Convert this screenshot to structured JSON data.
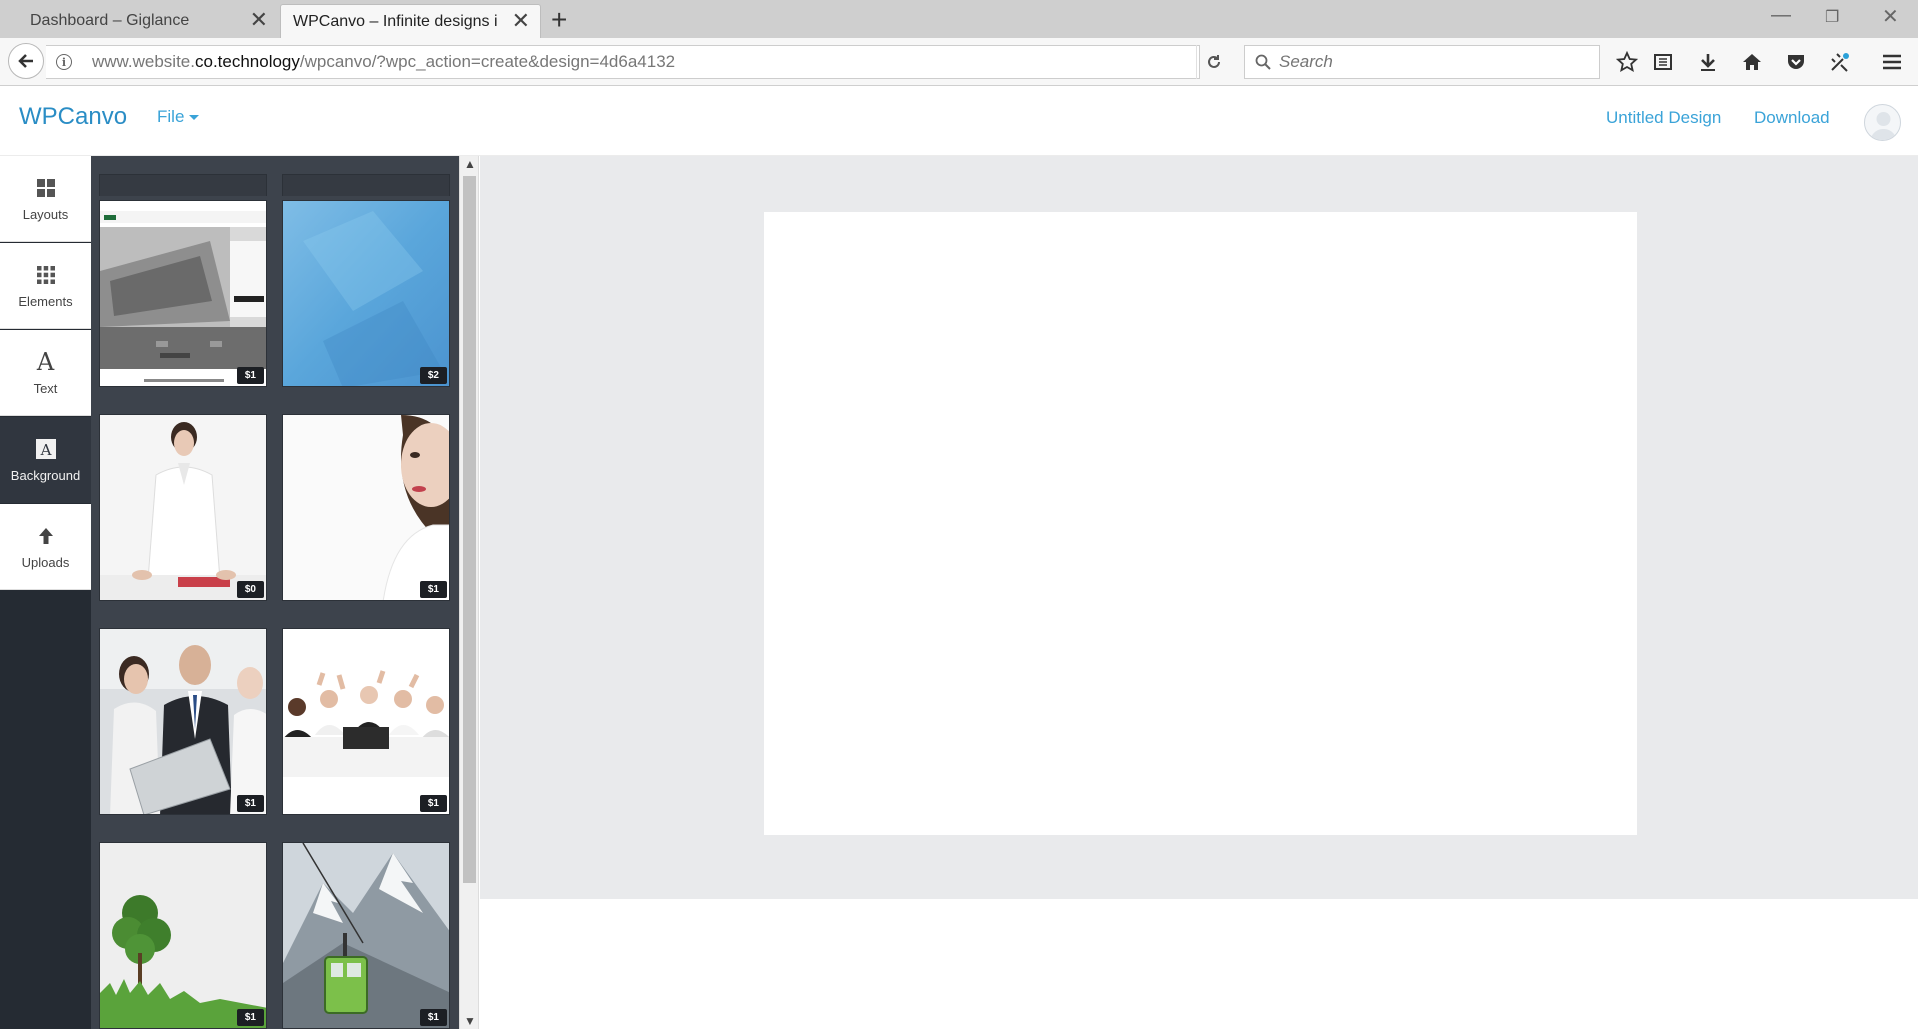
{
  "browser": {
    "tabs": [
      {
        "title": "Dashboard – Giglance",
        "active": false
      },
      {
        "title": "WPCanvo – Infinite designs in m",
        "active": true
      }
    ],
    "new_tab_label": "+",
    "window_controls": {
      "minimize": "—",
      "restore": "❐",
      "close": "✕"
    },
    "url": {
      "prefix": "www.website.",
      "domain": "co.technology",
      "path": "/wpcanvo/?wpc_action=create&design=4d6a4132"
    },
    "search_placeholder": "Search",
    "toolbar_icons": [
      "bookmark-star-icon",
      "reading-list-icon",
      "download-icon",
      "home-icon",
      "pocket-icon",
      "extension-icon",
      "menu-icon"
    ]
  },
  "app": {
    "logo": "WPCanvo",
    "file_menu": "File",
    "design_title": "Untitled Design",
    "download_label": "Download"
  },
  "sidebar": {
    "items": [
      {
        "label": "Layouts",
        "icon": "layouts-grid-icon",
        "active": false
      },
      {
        "label": "Elements",
        "icon": "elements-grid-icon",
        "active": false
      },
      {
        "label": "Text",
        "icon": "text-a-icon",
        "active": false
      },
      {
        "label": "Background",
        "icon": "background-icon",
        "active": true
      },
      {
        "label": "Uploads",
        "icon": "upload-arrow-icon",
        "active": false
      }
    ]
  },
  "backgrounds": {
    "items": [
      {
        "subject": "website mockup",
        "price": "$1"
      },
      {
        "subject": "blue texture",
        "price": "$2"
      },
      {
        "subject": "businesswoman at desk",
        "price": "$0"
      },
      {
        "subject": "woman portrait",
        "price": "$1"
      },
      {
        "subject": "business team with folder",
        "price": "$1"
      },
      {
        "subject": "celebrating office team",
        "price": "$1"
      },
      {
        "subject": "small tree on grass",
        "price": "$1"
      },
      {
        "subject": "cable car in snowy mountains",
        "price": "$1"
      }
    ]
  },
  "colors": {
    "accent": "#3aa3d8",
    "logo": "#2a8dc5",
    "sidebar_bg": "#252b33",
    "panel_bg": "#3d434c",
    "workspace_bg": "#e9eaec"
  }
}
